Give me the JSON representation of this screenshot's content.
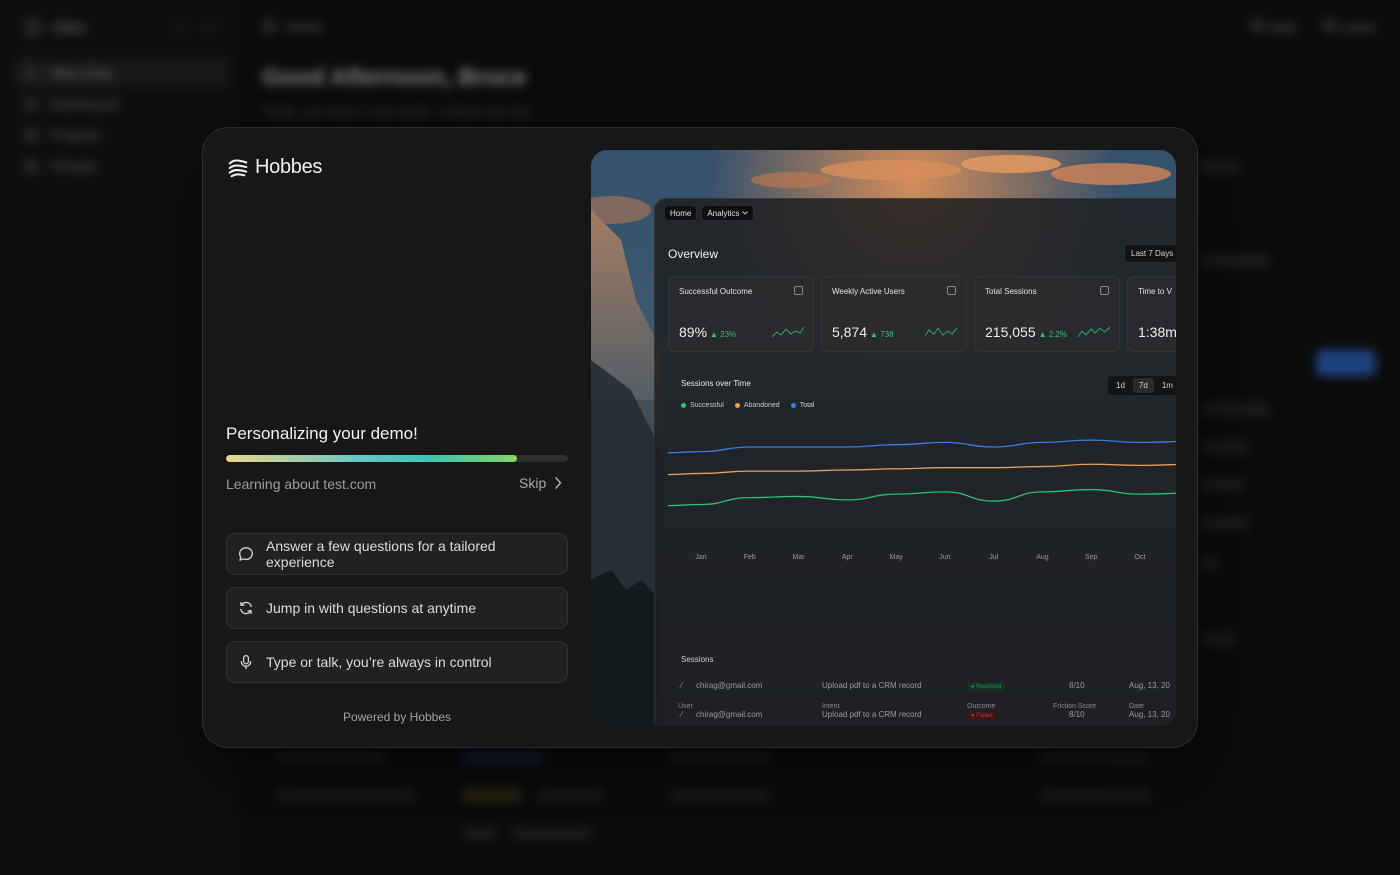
{
  "background": {
    "brand": "Atlas",
    "nav": [
      "New Chat",
      "Dashboard",
      "Projects",
      "Virtuals"
    ],
    "topbar": {
      "title": "Home",
      "actions": [
        "Help",
        "Learn"
      ]
    },
    "greeting": "Good Afternoon, Bruce",
    "subtitle": "Today, you have 3 new leads, 2 follow-ups due"
  },
  "modal": {
    "logo_text": "Hobbes",
    "title": "Personalizing your demo!",
    "progress": 0.85,
    "status": "Learning about test.com",
    "skip_label": "Skip",
    "options": [
      {
        "icon": "chat-bubble-icon",
        "label": "Answer a few questions for a tailored experience"
      },
      {
        "icon": "refresh-icon",
        "label": "Jump in with questions at anytime"
      },
      {
        "icon": "microphone-icon",
        "label": "Type or talk, you’re always in control"
      }
    ],
    "powered_by": "Powered by Hobbes"
  },
  "preview": {
    "breadcrumbs": [
      "Home",
      "Analytics"
    ],
    "overview_title": "Overview",
    "date_range": "Last 7 Days",
    "kpis": [
      {
        "label": "Successful Outcome",
        "value": "89%",
        "delta": "▲ 23%"
      },
      {
        "label": "Weekly Active Users",
        "value": "5,874",
        "delta": "▲ 738"
      },
      {
        "label": "Total Sessions",
        "value": "215,055",
        "delta": "▲ 2.2%"
      },
      {
        "label": "Time to V",
        "value": "1:38m",
        "delta": ""
      }
    ],
    "sessions_chart_title": "Sessions over Time",
    "range_tabs": [
      "1d",
      "7d",
      "1m"
    ],
    "active_range": "7d",
    "sessions_title": "Sessions",
    "table_headers": [
      "User",
      "Intent",
      "Outcome",
      "Friction Score",
      "Date"
    ],
    "table_rows": [
      {
        "user": "chirag@gmail.com",
        "intent": "Upload pdf to a CRM record",
        "outcome": "Resolved",
        "score": "8/10",
        "date": "Aug, 13, 20"
      },
      {
        "user": "chirag@gmail.com",
        "intent": "Upload pdf to a CRM record",
        "outcome": "Failed",
        "score": "8/10",
        "date": "Aug, 13, 20"
      }
    ]
  },
  "chart_data": {
    "type": "line",
    "title": "Sessions over Time",
    "categories": [
      "Jan",
      "Feb",
      "Mar",
      "Apr",
      "May",
      "Jun",
      "Jul",
      "Aug",
      "Sep",
      "Oct"
    ],
    "series": [
      {
        "name": "Successful",
        "color": "#2fbf71",
        "values": [
          30,
          36,
          37,
          34,
          39,
          41,
          33,
          41,
          43,
          39
        ]
      },
      {
        "name": "Abandoned",
        "color": "#e6a15c",
        "values": [
          57,
          59,
          59,
          60,
          61,
          62,
          62,
          63,
          65,
          64
        ]
      },
      {
        "name": "Total",
        "color": "#3b7fe6",
        "values": [
          76,
          80,
          80,
          80,
          82,
          84,
          80,
          84,
          86,
          84
        ]
      }
    ],
    "ylim": [
      0,
      100
    ]
  }
}
